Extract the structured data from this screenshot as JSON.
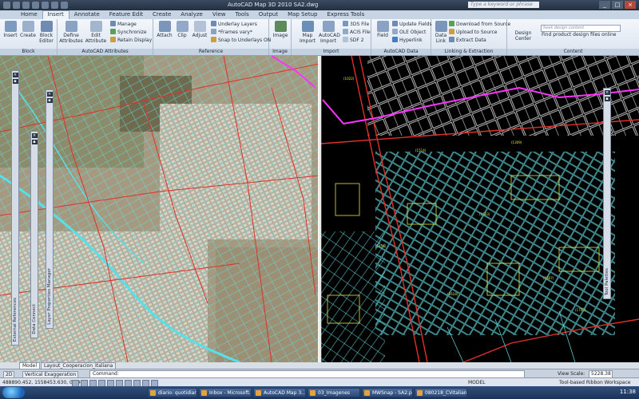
{
  "app": {
    "title": "AutoCAD Map 3D 2010    SA2.dwg",
    "search_placeholder": "Type a keyword or phrase"
  },
  "tabs": [
    {
      "label": "Home"
    },
    {
      "label": "Insert",
      "active": true
    },
    {
      "label": "Annotate"
    },
    {
      "label": "Feature Edit"
    },
    {
      "label": "Create"
    },
    {
      "label": "Analyze"
    },
    {
      "label": "View"
    },
    {
      "label": "Tools"
    },
    {
      "label": "Output"
    },
    {
      "label": "Map Setup"
    },
    {
      "label": "Express Tools"
    }
  ],
  "ribbon": {
    "block": {
      "title": "Block",
      "insert": "Insert",
      "create": "Create",
      "block_editor": "Block Editor"
    },
    "attributes": {
      "title": "AutoCAD Attributes",
      "define": "Define Attributes",
      "edit": "Edit Attribute",
      "manage": "Manage",
      "synchronize": "Synchronize",
      "retain_display": "Retain Display"
    },
    "reference": {
      "title": "Reference",
      "attach": "Attach",
      "clip": "Clip",
      "adjust": "Adjust",
      "underlay_layers": "Underlay Layers",
      "frames_vary": "*Frames vary*",
      "snap_underlays": "Snap to Underlays ON"
    },
    "image": {
      "title": "Image",
      "image": "Image"
    },
    "import": {
      "title": "Import",
      "map_import": "Map Import",
      "autocad_import": "AutoCAD Import",
      "file_3ds": "3DS File",
      "acis_file": "ACIS File",
      "pdf2": "SDF 2"
    },
    "data": {
      "title": "AutoCAD Data",
      "field": "Field",
      "update_fields": "Update Fields",
      "ole_object": "OLE Object",
      "hyperlink": "Hyperlink"
    },
    "linking": {
      "title": "Linking & Extraction",
      "data_link": "Data Link",
      "download": "Download from Source",
      "upload": "Upload to Source",
      "extract": "Extract Data"
    },
    "content": {
      "title": "Content",
      "design_center": "Design Center",
      "search_placeholder": "Seek design content",
      "find": "Find product design files online"
    }
  },
  "palettes": {
    "external_references": "External References",
    "data_connect": "Data Connect",
    "layer_properties": "Layer Properties Manager",
    "tool_palettes": "Tool Palettes"
  },
  "layout_tabs": [
    "Model",
    "Layout_Cooperacion_Italiana"
  ],
  "command_line": {
    "label": "Command:",
    "vertical_exaggeration": "Vertical Exaggeration",
    "view_scale_label": "View Scale:",
    "view_scale_value": "5228.38"
  },
  "status": {
    "coords": "488890.452, 1558453.630, 0.000",
    "model": "MODEL",
    "workspace": "Tool-based Ribbon Workspace"
  },
  "taskbar": {
    "items": [
      "diario: quotidian...",
      "Inbox - Microsoft...",
      "AutoCAD Map 3...",
      "03_Imagenes",
      "MWSnap - SA2.p...",
      "080218_CVitalian..."
    ],
    "clock": "11:38"
  },
  "colors": {
    "ribbon_bg": "#dbe4f0",
    "model_space_bg": "#000000",
    "parcel_color": "#66e0e6",
    "road_color": "#e0302a",
    "route_color": "#ff33ff",
    "label_color": "#e6e63a"
  }
}
